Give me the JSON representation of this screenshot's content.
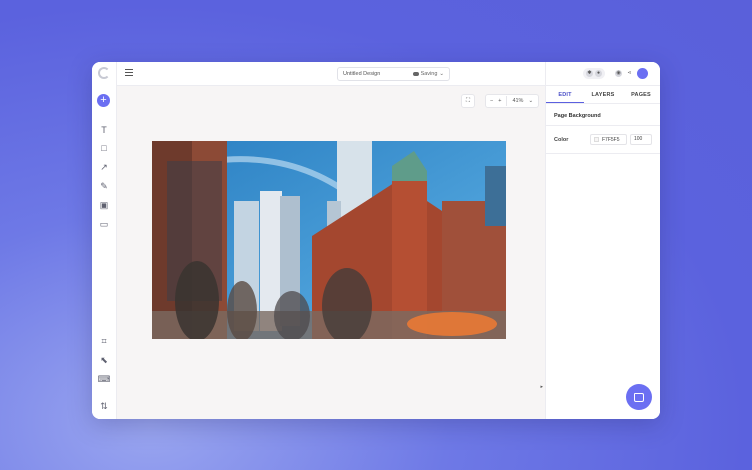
{
  "toolbar": {
    "add_label": "+",
    "tools": [
      "T",
      "□",
      "↗",
      "✎",
      "▣",
      "▭"
    ],
    "bottom_tools": [
      "⌗",
      "⬉",
      "⌨",
      "⇅"
    ]
  },
  "header": {
    "design_title": "Untitled Design",
    "save_status": "Saving",
    "zoom_value": "41%",
    "zoom_minus": "−",
    "zoom_plus": "+"
  },
  "panel": {
    "tabs": [
      {
        "label": "EDIT",
        "active": true
      },
      {
        "label": "LAYERS",
        "active": false
      },
      {
        "label": "PAGES",
        "active": false
      }
    ],
    "section_title": "Page Background",
    "color_label": "Color",
    "color_hex": "F7F5F5",
    "opacity": "100"
  },
  "colors": {
    "accent": "#6b6ff2",
    "canvas_bg": "#F7F5F5",
    "sky": "#2f88c9"
  }
}
